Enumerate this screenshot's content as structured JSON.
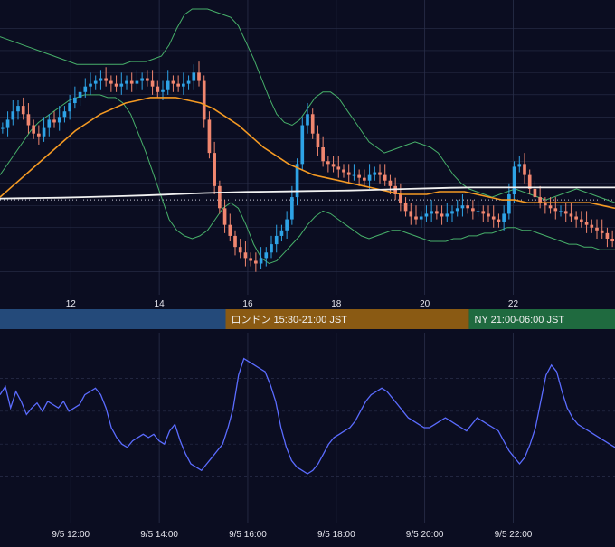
{
  "colors": {
    "background": "#0b0d21",
    "grid": "#2a2f4a",
    "candle_up": "#2ea3e6",
    "candle_down": "#f0866f",
    "bollinger": "#47b06a",
    "ma_short": "#f59a23",
    "ma_long": "#f2f2f2",
    "oscillator": "#5b6cff",
    "session_tokyo": "#244a7a",
    "session_london": "#8a5a13",
    "session_ny": "#1f6a3f"
  },
  "sessions": [
    {
      "label": "",
      "start": 10.4,
      "end": 15.5
    },
    {
      "label": "ロンドン 15:30-21:00 JST",
      "start": 15.5,
      "end": 21.0
    },
    {
      "label": "NY 21:00-06:00 JST",
      "start": 21.0,
      "end": 24.3
    }
  ],
  "chart_data": [
    {
      "type": "candlestick",
      "x_unit": "hour (9/5)",
      "xlim": [
        10.4,
        24.3
      ],
      "x_ticks": [
        12,
        14,
        16,
        18,
        20,
        22
      ],
      "x_tick_labels": [
        "12",
        "14",
        "16",
        "18",
        "20",
        "22"
      ],
      "ylim": [
        0,
        100
      ],
      "reference_level": 31,
      "close": [
        57,
        60,
        63,
        65,
        62,
        58,
        55,
        54,
        57,
        60,
        59,
        61,
        63,
        66,
        68,
        70,
        72,
        73,
        74,
        75,
        74,
        73,
        72,
        73,
        74,
        73,
        74,
        75,
        74,
        72,
        70,
        71,
        74,
        73,
        72,
        73,
        74,
        77,
        74,
        60,
        48,
        36,
        28,
        22,
        18,
        14,
        12,
        10,
        9,
        8,
        10,
        12,
        15,
        18,
        20,
        24,
        32,
        44,
        58,
        62,
        55,
        50,
        45,
        44,
        43,
        42,
        41,
        40,
        40,
        39,
        38,
        40,
        41,
        40,
        38,
        36,
        33,
        30,
        27,
        25,
        24,
        25,
        26,
        27,
        26,
        25,
        26,
        27,
        28,
        29,
        28,
        27,
        27,
        26,
        25,
        24,
        23,
        26,
        33,
        43,
        44,
        40,
        35,
        32,
        30,
        29,
        28,
        27,
        27,
        26,
        25,
        24,
        23,
        22,
        21,
        20,
        19,
        17,
        16
      ],
      "open": [
        57,
        57,
        60,
        63,
        65,
        62,
        58,
        55,
        54,
        57,
        60,
        59,
        61,
        63,
        66,
        68,
        70,
        72,
        73,
        74,
        75,
        74,
        73,
        72,
        73,
        74,
        73,
        74,
        75,
        74,
        72,
        70,
        71,
        74,
        73,
        72,
        73,
        74,
        77,
        74,
        60,
        48,
        36,
        28,
        22,
        18,
        14,
        12,
        10,
        9,
        8,
        10,
        12,
        15,
        18,
        20,
        24,
        32,
        44,
        58,
        62,
        55,
        50,
        45,
        44,
        43,
        42,
        41,
        40,
        40,
        39,
        38,
        40,
        41,
        40,
        38,
        36,
        33,
        30,
        27,
        25,
        24,
        25,
        26,
        27,
        26,
        25,
        26,
        27,
        28,
        29,
        28,
        27,
        27,
        26,
        25,
        24,
        23,
        26,
        33,
        43,
        44,
        40,
        35,
        32,
        30,
        29,
        28,
        27,
        27,
        26,
        25,
        24,
        23,
        22,
        21,
        20,
        19,
        17
      ],
      "bollinger_upper": [
        90,
        89,
        88,
        87,
        86,
        85,
        84,
        83,
        82,
        81,
        80,
        80,
        80,
        80,
        80,
        80,
        80,
        81,
        81,
        81,
        82,
        83,
        87,
        93,
        98,
        100,
        100,
        100,
        99,
        98,
        97,
        94,
        88,
        82,
        75,
        68,
        62,
        59,
        58,
        60,
        64,
        68,
        70,
        70,
        68,
        64,
        60,
        56,
        52,
        50,
        48,
        49,
        50,
        51,
        52,
        51,
        50,
        48,
        44,
        40,
        37,
        35,
        34,
        33,
        32,
        33,
        34,
        35,
        34,
        33,
        32,
        31,
        32,
        33,
        34,
        35,
        34,
        33,
        32,
        31,
        30
      ],
      "bollinger_lower": [
        40,
        44,
        48,
        52,
        56,
        59,
        61,
        63,
        65,
        67,
        68,
        69,
        69,
        69,
        68,
        68,
        66,
        62,
        55,
        48,
        40,
        32,
        24,
        20,
        18,
        17,
        18,
        20,
        24,
        28,
        30,
        28,
        22,
        15,
        10,
        8,
        9,
        12,
        15,
        18,
        22,
        25,
        27,
        26,
        24,
        22,
        20,
        18,
        17,
        18,
        19,
        20,
        20,
        19,
        18,
        17,
        16,
        16,
        16,
        17,
        17,
        18,
        18,
        19,
        19,
        20,
        21,
        21,
        20,
        20,
        19,
        18,
        17,
        16,
        15,
        15,
        14,
        14,
        13,
        13,
        13
      ],
      "ma_short": [
        32,
        36,
        40,
        44,
        48,
        52,
        56,
        59,
        62,
        64,
        66,
        67,
        68,
        68,
        68,
        67,
        66,
        64,
        61,
        58,
        54,
        50,
        47,
        44,
        42,
        40,
        39,
        38,
        37,
        36,
        35,
        34,
        33,
        33,
        33,
        34,
        34,
        34,
        33,
        32,
        31,
        31,
        30,
        30,
        30,
        30,
        30,
        30,
        29,
        28
      ],
      "ma_long": [
        31.5,
        31.6,
        31.7,
        31.8,
        32.0,
        32.2,
        32.4,
        32.6,
        32.9,
        33.2,
        33.5,
        33.7,
        33.9,
        34.0,
        34.1,
        34.2,
        34.3,
        34.4,
        34.6,
        34.8,
        35.0,
        35.2,
        35.4,
        35.5,
        35.5,
        35.5,
        35.5,
        35.5,
        35.5,
        35.5,
        35.5
      ]
    },
    {
      "type": "line",
      "x_unit": "time (9/5)",
      "xlim": [
        10.4,
        24.3
      ],
      "ylim": [
        0,
        100
      ],
      "x_ticks": [
        12,
        14,
        16,
        18,
        20,
        22
      ],
      "x_tick_labels": [
        "9/5 12:00",
        "9/5 14:00",
        "9/5 16:00",
        "9/5 18:00",
        "9/5 20:00",
        "9/5 22:00"
      ],
      "series": [
        {
          "values": [
            70,
            75,
            62,
            72,
            66,
            58,
            62,
            65,
            60,
            66,
            64,
            62,
            66,
            60,
            62,
            64,
            70,
            72,
            74,
            70,
            62,
            50,
            44,
            40,
            38,
            42,
            44,
            46,
            44,
            46,
            42,
            40,
            48,
            52,
            42,
            34,
            28,
            26,
            24,
            28,
            32,
            36,
            40,
            50,
            62,
            82,
            92,
            90,
            88,
            86,
            84,
            76,
            66,
            50,
            38,
            30,
            26,
            24,
            22,
            24,
            28,
            34,
            40,
            44,
            46,
            48,
            50,
            54,
            60,
            66,
            70,
            72,
            74,
            72,
            68,
            64,
            60,
            56,
            54,
            52,
            50,
            50,
            52,
            54,
            56,
            54,
            52,
            50,
            48,
            52,
            56,
            54,
            52,
            50,
            48,
            42,
            36,
            32,
            28,
            32,
            40,
            50,
            66,
            82,
            88,
            84,
            72,
            62,
            56,
            52,
            50,
            48,
            46,
            44,
            42,
            40,
            38
          ]
        }
      ]
    }
  ]
}
